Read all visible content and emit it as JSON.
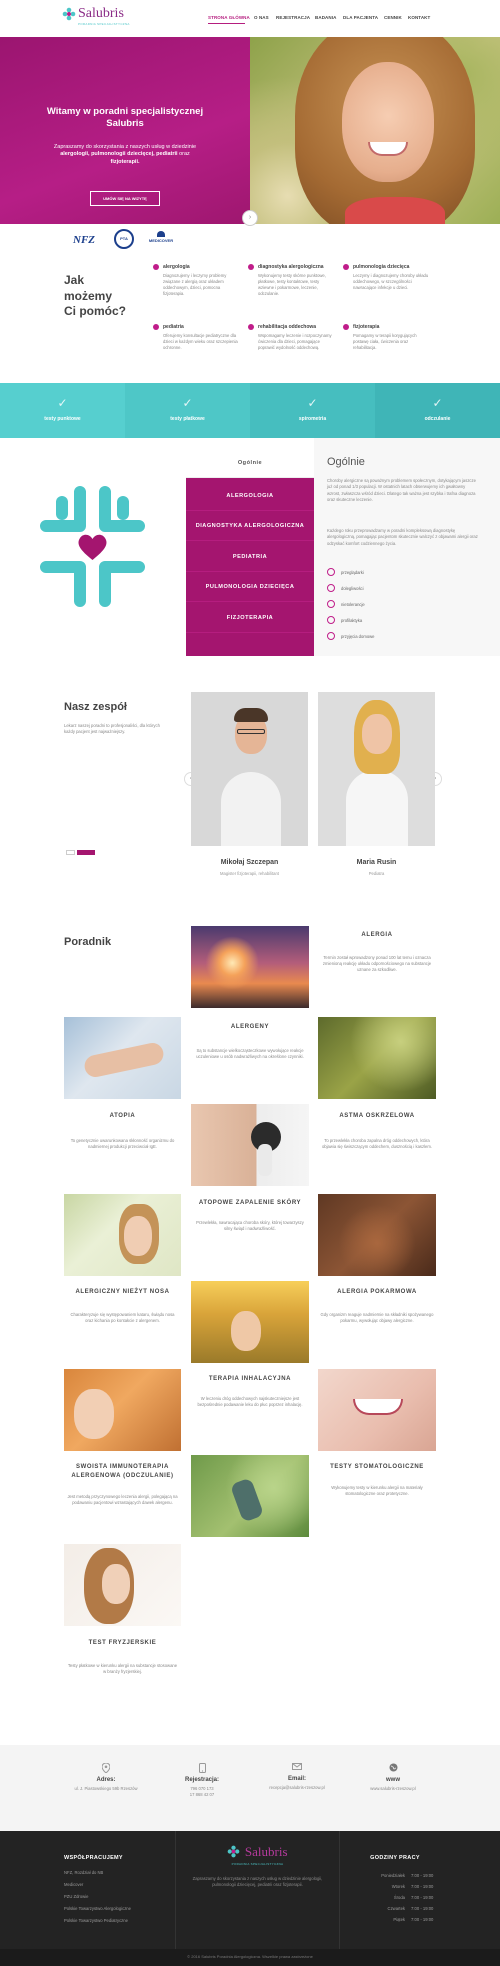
{
  "header": {
    "logo_text": "Salubris",
    "logo_sub": "PORADNIA SPECJALISTYCZNA",
    "nav": [
      "STRONA GŁÓWNA",
      "O NAS",
      "REJESTRACJA",
      "BADANIA",
      "DLA PACJENTA",
      "CENNIK",
      "KONTAKT"
    ],
    "active_nav": "STRONA GŁÓWNA"
  },
  "hero": {
    "title": "Witamy w poradni specjalistycznej Salubris",
    "text_pre": "Zapraszamy do skorzystania z naszych usług w dziedzinie ",
    "text_bold1": "alergologii, pulmonologii dziecięcej, pediatrii",
    "text_mid": " oraz ",
    "text_bold2": "fizjoterapii.",
    "button": "UMÓW SIĘ NA WIZYTĘ",
    "partners": [
      "NFZ",
      "PTA",
      "MEDICOVER"
    ]
  },
  "help": {
    "title_l1": "Jak",
    "title_l2": "możemy",
    "title_l3": "Ci pomóc?",
    "services": [
      {
        "title": "alergologia",
        "desc": "Diagnozujemy i leczymy problemy związane z alergią oraz układem oddechowym, dzieci, pomocna fizjoterapia."
      },
      {
        "title": "diagnostyka alergologiczna",
        "desc": "Wykonujemy testy skórne punktowe, płatkowe, testy kontaktowe, testy wziewne i pokarmowe, leczenie, odczulanie."
      },
      {
        "title": "pulmonologia dziecięca",
        "desc": "Leczymy i diagnozujemy choroby układu oddechowego, w szczególności nawracające infekcje u dzieci."
      },
      {
        "title": "pediatria",
        "desc": "Oferujemy konsultacje pediatryczne dla dzieci w każdym wieku oraz szczepienia ochronne."
      },
      {
        "title": "rehabilitacja oddechowa",
        "desc": "Wspomagamy leczenie i rozpoczynamy ćwiczenia dla dzieci, pomagające poprawić wydolność oddechową."
      },
      {
        "title": "fizjoterapia",
        "desc": "Pomagamy w terapii korygujących postawę ciała, ćwiczenia oraz rehabilitacja."
      }
    ]
  },
  "strip": [
    "testy punktowe",
    "testy płatkowe",
    "spirometria",
    "odczulanie"
  ],
  "tabs": {
    "items": [
      "Ogólnie",
      "ALERGOLOGIA",
      "DIAGNOSTYKA ALERGOLOGICZNA",
      "PEDIATRIA",
      "PULMONOLOGIA DZIECIĘCA",
      "FIZJOTERAPIA"
    ],
    "heading": "Ogólnie",
    "p1": "Choroby alergiczne są poważnym problemem społecznym, dotykającym jaszcze już od ponad 1/3 populacji. W ostatnich latach obserwujemy ich gwałtowny wzrost, zwłaszcza wśród dzieci. Dlatego tak ważna jest szybka i trafna diagnoza oraz skuteczne leczenie.",
    "p2": "Każdego roku przeprowadzamy w poradni kompleksową diagnostykę alergologiczną, pomagając pacjentom skutecznie walczyć z objawami alergii oraz odzyskać komfort codziennego życia.",
    "list": [
      "przeglądarki",
      "dolegliwości",
      "nietolerancje",
      "profilaktyka",
      "przyjęcia domowe"
    ]
  },
  "team": {
    "title": "Nasz zespół",
    "desc": "Lekarz naszej poradni to profesjonaliści, dla których każdy pacjent jest najważniejszy.",
    "members": [
      {
        "name": "Mikołaj Szczepan",
        "role": "Magister fizjoterapii, rehabilitant"
      },
      {
        "name": "Maria Rusin",
        "role": "Pediatra"
      }
    ]
  },
  "guide": {
    "title": "Poradnik",
    "articles": [
      {
        "title": "ALERGIA",
        "desc": "Termin został wprowadzony ponad 100 lat temu i oznacza zmienioną reakcję układu odpornościowego na substancje uznane za szkodliwe."
      },
      {
        "title": "ALERGENY",
        "desc": "Są to substancje wielkocząsteczkowe wywołujące reakcje uczuleniowe u osób nadwrażliwych na określone czynniki."
      },
      {
        "title": "ATOPIA",
        "desc": "To genetycznie uwarunkowana skłonność organizmu do nadmiernej produkcji przeciwciał IgE."
      },
      {
        "title": "ASTMA OSKRZELOWA",
        "desc": "To przewlekła choroba zapalna dróg oddechowych, która objawia się świszczącym oddechem, dusznością i kaszlem."
      },
      {
        "title": "ATOPOWE ZAPALENIE SKÓRY",
        "desc": "Przewlekła, nawracająca choroba skóry, której towarzyszy silny świąd i nadwrażliwość."
      },
      {
        "title": "ALERGICZNY NIEŻYT NOSA",
        "desc": "Charakteryzuje się występowaniem kataru, świądu nosa oraz kichania po kontakcie z alergenem."
      },
      {
        "title": "ALERGIA POKARMOWA",
        "desc": "Gdy organizm reaguje nadmiernie na składniki spożywanego pokarmu, wywołując objawy alergiczne."
      },
      {
        "title": "TERAPIA INHALACYJNA",
        "desc": "W leczeniu dróg oddechowych najskuteczniejsze jest bezpośrednie podawanie leku do płuc poprzez inhalację."
      },
      {
        "title": "SWOISTA IMMUNOTERAPIA ALERGENOWA (ODCZULANIE)",
        "desc": "Jest metodą przyczynowego leczenia alergii, polegającą na podawaniu pacjentowi wzrastających dawek alergenu."
      },
      {
        "title": "TESTY STOMATOLOGICZNE",
        "desc": "Wykonujemy testy w kierunku alergii na materiały stomatologiczne oraz protetyczne."
      },
      {
        "title": "TEST FRYZJERSKIE",
        "desc": "Testy płatkowe w kierunku alergii na substancje stosowane w branży fryzjerskiej."
      }
    ]
  },
  "contact": [
    {
      "label": "Adres:",
      "value": "ul. J. Piastowskiego 59b Rzeszów"
    },
    {
      "label": "Rejestracja:",
      "value": "796 070 173",
      "value2": "17 868 42 07"
    },
    {
      "label": "Email:",
      "value": "recepcja@salubris-rzeszow.pl"
    },
    {
      "label": "www",
      "value": "www.salubris-rzeszow.pl"
    }
  ],
  "footer": {
    "coop_title": "WSPÓŁPRACUJEMY",
    "coop_items": [
      "NFZ, Rozdział do NB",
      "Medicover",
      "PZU Zdrowie",
      "Polskie Towarzystwo Alergologiczne",
      "Polskie Towarzystwo Pediatryczne"
    ],
    "logo_text": "Salubris",
    "logo_sub": "PORADNIA SPECJALISTYCZNA",
    "about": "Zapraszamy do skorzystania z naszych usług w dziedzinie alergologii, pulmonologii dziecięcej, pediatrii oraz fizjoterapii.",
    "hours_title": "GODZINY PRACY",
    "hours": [
      {
        "day": "Poniedziałek",
        "time": "7:00 - 19:00"
      },
      {
        "day": "Wtorek",
        "time": "7:00 - 19:00"
      },
      {
        "day": "Środa",
        "time": "7:00 - 19:00"
      },
      {
        "day": "Czwartek",
        "time": "7:00 - 19:00"
      },
      {
        "day": "Piątek",
        "time": "7:00 - 19:00"
      }
    ],
    "copyright": "© 2016 Salubris Poradnia Alergologiczna. Wszelkie prawa zastrzeżone"
  },
  "colors": {
    "primary": "#a4156f",
    "accent": "#4cc6c8",
    "dark": "#1f1f1f"
  }
}
